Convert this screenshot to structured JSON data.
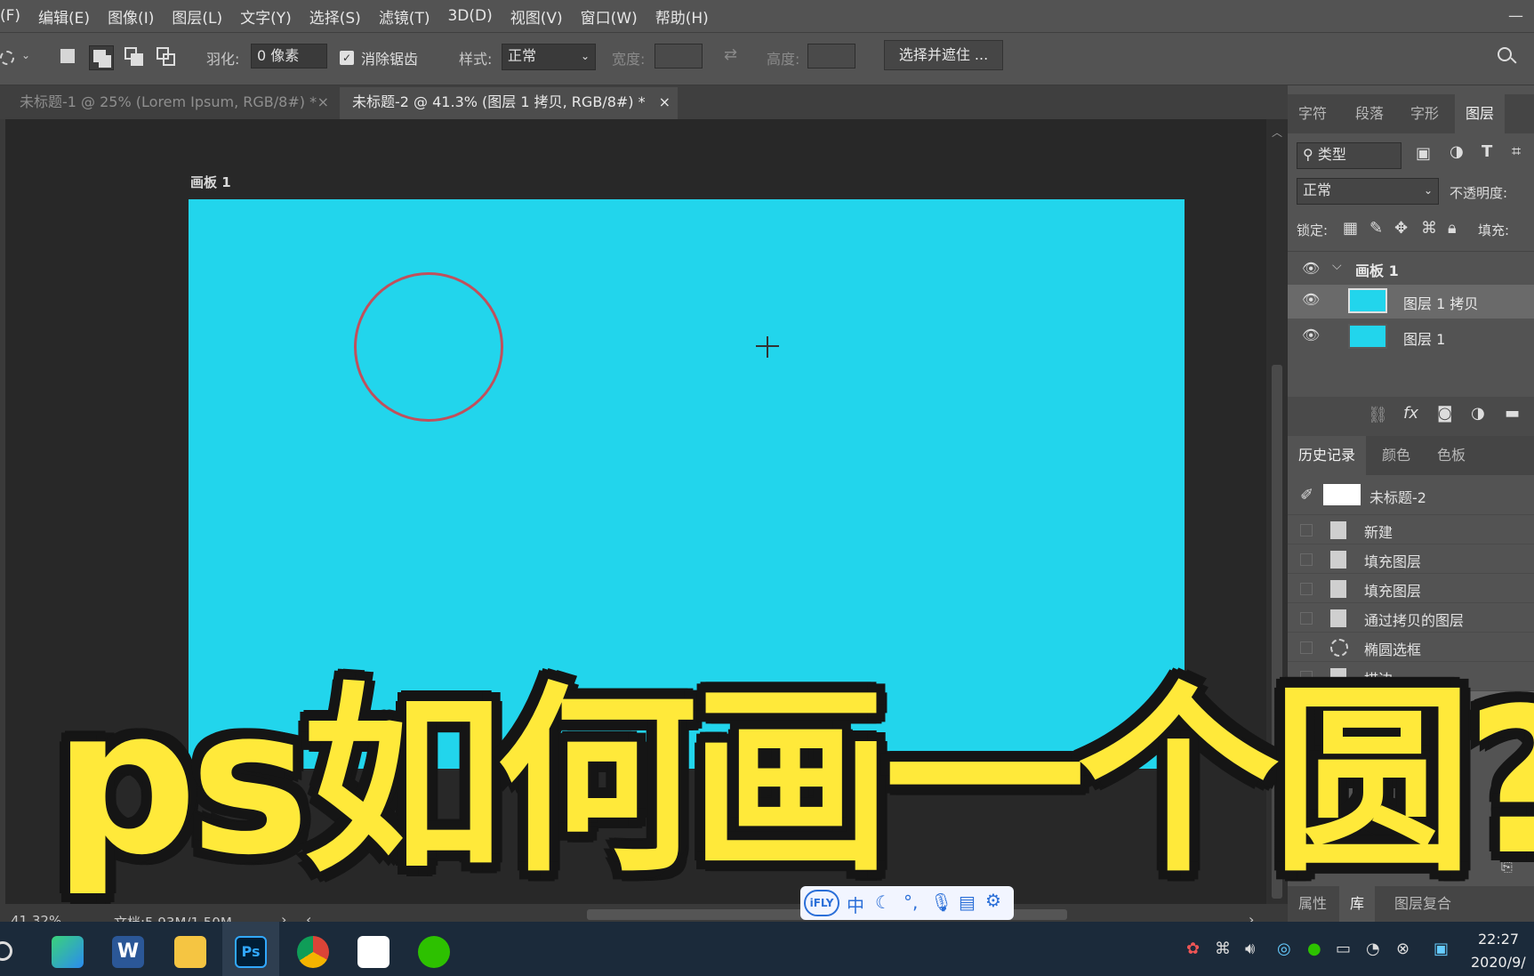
{
  "menu": [
    "文件(F)",
    "编辑(E)",
    "图像(I)",
    "图层(L)",
    "文字(Y)",
    "选择(S)",
    "滤镜(T)",
    "3D(D)",
    "视图(V)",
    "窗口(W)",
    "帮助(H)"
  ],
  "menu_first_visible": "(F)",
  "options": {
    "feather_label": "羽化:",
    "feather_value": "0 像素",
    "antialias_label": "消除锯齿",
    "style_label": "样式:",
    "style_value": "正常",
    "width_label": "宽度:",
    "height_label": "高度:",
    "select_mask_button": "选择并遮住 ..."
  },
  "tabs": [
    {
      "label": "未标题-1 @ 25% (Lorem Ipsum, RGB/8#) *",
      "active": false
    },
    {
      "label": "未标题-2 @ 41.3% (图层 1 拷贝, RGB/8#) *",
      "active": true
    }
  ],
  "tab_close": "×",
  "artboard_label": "画板 1",
  "colors": {
    "canvas": "#22d5ec",
    "circle_stroke": "#c0505c",
    "title_text": "#ffe93a"
  },
  "status": {
    "zoom": "41.32%",
    "doc": "文档:5.93M/1.50M"
  },
  "panel_tabs_top": [
    "字符",
    "段落",
    "字形",
    "图层"
  ],
  "layers_panel": {
    "filter_label": "类型",
    "blend_mode": "正常",
    "opacity_label": "不透明度:",
    "lock_label": "锁定:",
    "fill_label": "填充:",
    "group_name": "画板 1",
    "layers": [
      {
        "name": "图层 1 拷贝",
        "selected": true
      },
      {
        "name": "图层 1",
        "selected": false
      }
    ]
  },
  "panel_tabs_mid": [
    "历史记录",
    "颜色",
    "色板"
  ],
  "history": {
    "snapshot": "未标题-2",
    "items": [
      "新建",
      "填充图层",
      "填充图层",
      "通过拷贝的图层",
      "椭圆选框",
      "描边"
    ]
  },
  "panel_tabs_bottom": [
    "属性",
    "库",
    "图层复合"
  ],
  "overlay_title": "ps如何画一个圆?",
  "ime": {
    "brand": "iFLY",
    "mode": "中"
  },
  "taskbar": {
    "time": "22:27",
    "date": "2020/9/"
  }
}
